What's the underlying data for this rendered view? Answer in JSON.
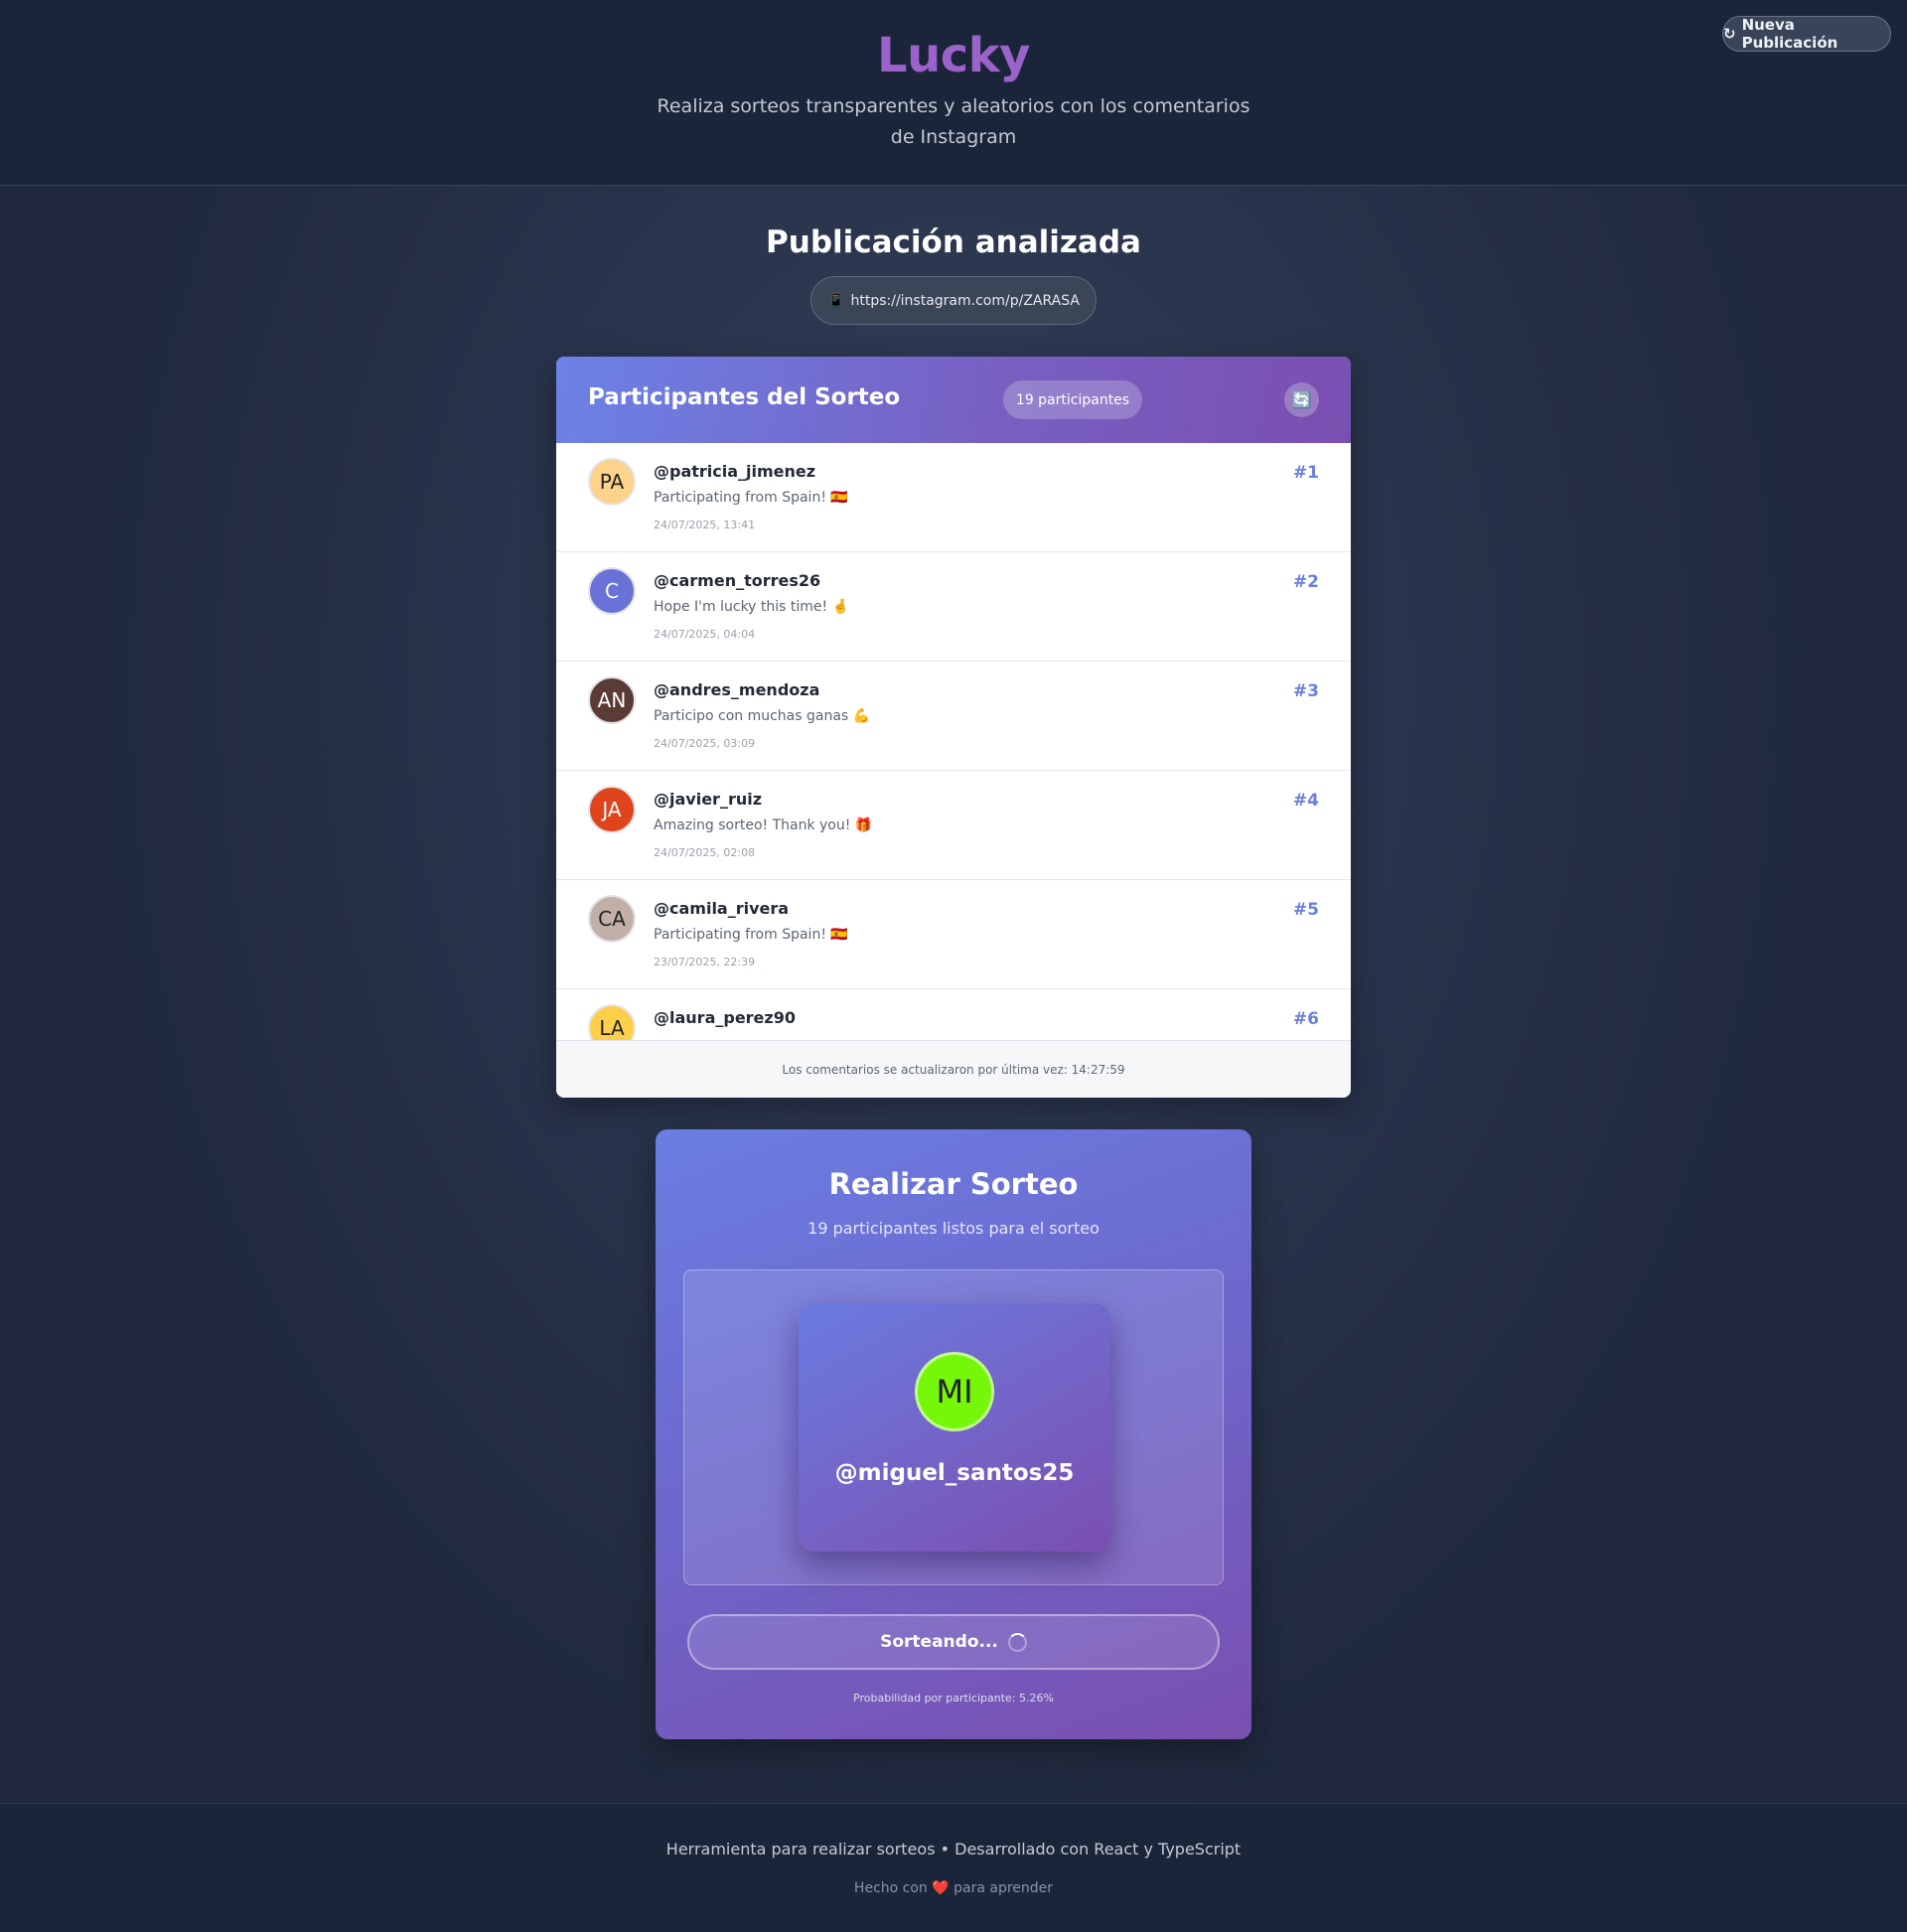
{
  "header": {
    "brand": "Lucky",
    "tagline": "Realiza sorteos transparentes y aleatorios con los comentarios de Instagram",
    "new_post_button": "Nueva Publicación",
    "new_post_icon": "↻"
  },
  "post": {
    "title": "Publicación analizada",
    "url": "https://instagram.com/p/ZARASA",
    "url_icon": "📱"
  },
  "participants": {
    "title": "Participantes del Sorteo",
    "count_badge": "19 participantes",
    "refresh_icon": "🔄",
    "items": [
      {
        "initials": "PA",
        "avatar_color": "#fdd28a",
        "text_color": "#222222",
        "username": "@patricia_jimenez",
        "comment": "Participating from Spain! 🇪🇸",
        "date": "24/07/2025, 13:41",
        "rank": "#1"
      },
      {
        "initials": "C",
        "avatar_color": "#6a72d8",
        "text_color": "#ffffff",
        "username": "@carmen_torres26",
        "comment": "Hope I'm lucky this time! 🤞",
        "date": "24/07/2025, 04:04",
        "rank": "#2"
      },
      {
        "initials": "AN",
        "avatar_color": "#5a3b35",
        "text_color": "#ffffff",
        "username": "@andres_mendoza",
        "comment": "Participo con muchas ganas 💪",
        "date": "24/07/2025, 03:09",
        "rank": "#3"
      },
      {
        "initials": "JA",
        "avatar_color": "#e0441c",
        "text_color": "#ffffff",
        "username": "@javier_ruiz",
        "comment": "Amazing sorteo! Thank you! 🎁",
        "date": "24/07/2025, 02:08",
        "rank": "#4"
      },
      {
        "initials": "CA",
        "avatar_color": "#c2b0a8",
        "text_color": "#222222",
        "username": "@camila_rivera",
        "comment": "Participating from Spain! 🇪🇸",
        "date": "23/07/2025, 22:39",
        "rank": "#5"
      },
      {
        "initials": "LA",
        "avatar_color": "#fdcf4a",
        "text_color": "#222222",
        "username": "@laura_perez90",
        "comment": "",
        "date": "",
        "rank": "#6"
      }
    ],
    "footer_text": "Los comentarios se actualizaron por última vez: 14:27:59"
  },
  "draw": {
    "title": "Realizar Sorteo",
    "subtitle": "19 participantes listos para el sorteo",
    "winner_initials": "MI",
    "winner_avatar_color": "#76f70a",
    "winner_username": "@miguel_santos25",
    "button_label": "Sorteando...",
    "probability_text": "Probabilidad por participante: 5.26%"
  },
  "footer": {
    "line1": "Herramienta para realizar sorteos • Desarrollado con React y TypeScript",
    "line2_prefix": "Hecho con",
    "heart": "❤️",
    "line2_suffix": "para aprender"
  }
}
